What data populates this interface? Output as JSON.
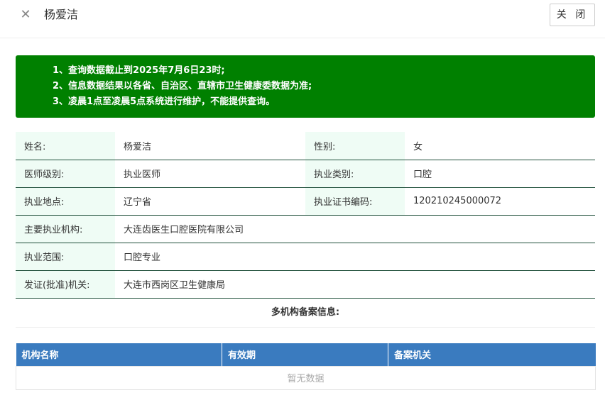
{
  "header": {
    "close_icon": "close-icon",
    "title": "杨爱洁",
    "close_button_label": "关 闭"
  },
  "notice": {
    "lines": [
      "1、查询数据截止到2025年7月6日23时;",
      "2、信息数据结果以各省、自治区、直辖市卫生健康委数据为准;",
      "3、凌晨1点至凌晨5点系统进行维护，不能提供查询。"
    ],
    "background": "#008000"
  },
  "info": {
    "name_label": "姓名:",
    "name_value": "杨爱洁",
    "gender_label": "性别:",
    "gender_value": "女",
    "level_label": "医师级别:",
    "level_value": "执业医师",
    "category_label": "执业类别:",
    "category_value": "口腔",
    "location_label": "执业地点:",
    "location_value": "辽宁省",
    "cert_label": "执业证书编码:",
    "cert_value": "120210245000072",
    "org_label": "主要执业机构:",
    "org_value": "大连齿医生口腔医院有限公司",
    "scope_label": "执业范围:",
    "scope_value": "口腔专业",
    "issuer_label": "发证(批准)机关:",
    "issuer_value": "大连市西岗区卫生健康局"
  },
  "multi_org": {
    "title": "多机构备案信息:",
    "columns": [
      "机构名称",
      "有效期",
      "备案机关"
    ],
    "empty_text": "暂无数据",
    "header_color": "#3a7bbf"
  }
}
